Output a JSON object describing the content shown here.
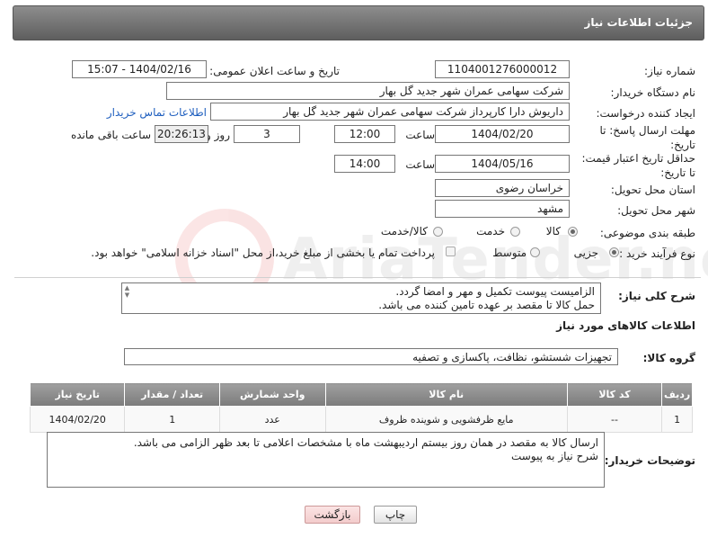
{
  "header": {
    "title": "جزئیات اطلاعات نیاز"
  },
  "need_number": {
    "label": "شماره نیاز:",
    "value": "1104001276000012"
  },
  "announce": {
    "label": "تاریخ و ساعت اعلان عمومی:",
    "value": "1404/02/16 - 15:07"
  },
  "buyer_org": {
    "label": "نام دستگاه خریدار:",
    "value": "شرکت سهامی عمران شهر جدید گل بهار"
  },
  "creator": {
    "label": "ایجاد کننده درخواست:",
    "value": "داریوش دارا کارپرداز شرکت سهامی عمران شهر جدید گل بهار",
    "contact_link": "اطلاعات تماس خریدار"
  },
  "deadline": {
    "label": "مهلت ارسال پاسخ: تا تاریخ:",
    "date": "1404/02/20",
    "time_label": "ساعت",
    "time": "12:00",
    "days": "3",
    "days_label": "روز و",
    "remaining": "20:26:13",
    "remaining_label": "ساعت باقی مانده"
  },
  "validity": {
    "label": "حداقل تاریخ اعتبار قیمت: تا تاریخ:",
    "date": "1404/05/16",
    "time_label": "ساعت",
    "time": "14:00"
  },
  "province": {
    "label": "استان محل تحویل:",
    "value": "خراسان رضوی"
  },
  "city": {
    "label": "شهر محل تحویل:",
    "value": "مشهد"
  },
  "category": {
    "label": "طبقه بندی موضوعی:",
    "options": [
      "کالا",
      "خدمت",
      "کالا/خدمت"
    ],
    "selected": "کالا"
  },
  "process": {
    "label": "نوع فرآیند خرید :",
    "options": [
      "جزیی",
      "متوسط"
    ],
    "selected": "جزیی",
    "payment_note": "پرداخت تمام یا بخشی از مبلغ خرید،از محل \"اسناد خزانه اسلامی\" خواهد بود."
  },
  "description": {
    "label": "شرح کلی نیاز:",
    "line1": "الزامیست پیوست تکمیل و مهر و امضا گردد.",
    "line2": "حمل کالا تا مقصد بر عهده تامین کننده می باشد."
  },
  "goods_section": {
    "title": "اطلاعات کالاهای مورد نیاز"
  },
  "goods_group": {
    "label": "گروه کالا:",
    "value": "تجهیزات شستشو، نظافت، پاکسازی و تصفیه"
  },
  "table": {
    "headers": [
      "ردیف",
      "کد کالا",
      "نام کالا",
      "واحد شمارش",
      "تعداد / مقدار",
      "تاریخ نیاز"
    ],
    "rows": [
      {
        "row": "1",
        "code": "--",
        "name": "مایع ظرفشویی و شوینده ظروف",
        "unit": "عدد",
        "qty": "1",
        "date": "1404/02/20"
      }
    ]
  },
  "buyer_notes": {
    "label": "توضیحات خریدار:",
    "line1": "ارسال کالا به مقصد در همان روز بیستم اردیبهشت ماه با مشخصات اعلامی تا بعد ظهر الزامی می باشد.",
    "line2": "شرح نیاز به پیوست"
  },
  "buttons": {
    "print": "چاپ",
    "back": "بازگشت"
  },
  "watermark": {
    "text": "AriaTender.neT"
  },
  "colors": {
    "header_bg": "#7a7a7a",
    "link": "#1f5fbf",
    "back_button_bg": "#f7d9d9"
  }
}
